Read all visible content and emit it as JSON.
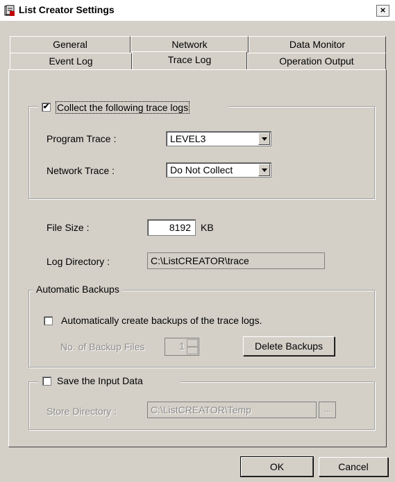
{
  "window": {
    "title": "List Creator Settings",
    "close_glyph": "×"
  },
  "tabs": {
    "row1": [
      "General",
      "Network",
      "Data Monitor"
    ],
    "row2": [
      "Event Log",
      "Trace Log",
      "Operation Output"
    ],
    "active": "Trace Log"
  },
  "trace": {
    "collect_label": "Collect the following trace logs",
    "collect_checked": true,
    "program_trace_label": "Program Trace :",
    "program_trace_value": "LEVEL3",
    "network_trace_label": "Network Trace :",
    "network_trace_value": "Do Not Collect"
  },
  "file": {
    "size_label": "File Size :",
    "size_value": "8192",
    "size_unit": "KB",
    "log_dir_label": "Log Directory :",
    "log_dir_value": "C:\\ListCREATOR\\trace"
  },
  "backups": {
    "group_label": "Automatic Backups",
    "auto_label": "Automatically create backups of the trace logs.",
    "auto_checked": false,
    "count_label": "No. of Backup Files",
    "count_value": "1",
    "delete_label": "Delete Backups"
  },
  "input_data": {
    "save_label": "Save the Input Data",
    "save_checked": false,
    "store_dir_label": "Store Directory :",
    "store_dir_value": "C:\\ListCREATOR\\Temp",
    "browse_label": "..."
  },
  "footer": {
    "ok_label": "OK",
    "cancel_label": "Cancel"
  },
  "check_glyph": "✔"
}
